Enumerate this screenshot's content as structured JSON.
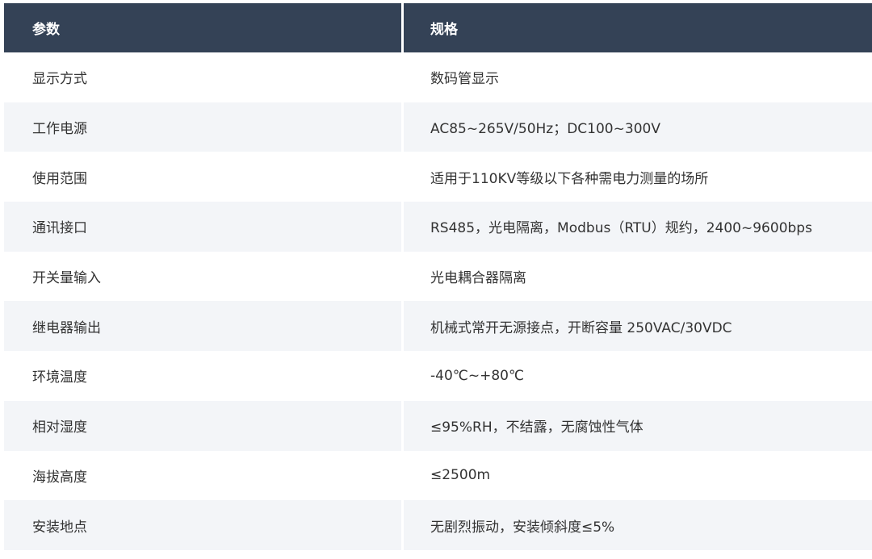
{
  "table": {
    "headers": [
      "参数",
      "规格"
    ],
    "rows": [
      [
        "显示方式",
        "数码管显示"
      ],
      [
        "工作电源",
        "AC85~265V/50Hz；DC100~300V"
      ],
      [
        "使用范围",
        "适用于110KV等级以下各种需电力测量的场所"
      ],
      [
        "通讯接口",
        "RS485，光电隔离，Modbus（RTU）规约，2400~9600bps"
      ],
      [
        "开关量输入",
        "光电耦合器隔离"
      ],
      [
        "继电器输出",
        "机械式常开无源接点，开断容量 250VAC/30VDC"
      ],
      [
        "环境温度",
        "-40℃~+80℃"
      ],
      [
        "相对湿度",
        "≤95%RH，不结露，无腐蚀性气体"
      ],
      [
        "海拔高度",
        "≤2500m"
      ],
      [
        "安装地点",
        "无剧烈振动，安装倾斜度≤5%"
      ]
    ]
  },
  "colors": {
    "header_bg": "#344256",
    "header_text": "#ffffff",
    "row_alt_bg": "#f3f5f8",
    "body_text": "#333333"
  }
}
